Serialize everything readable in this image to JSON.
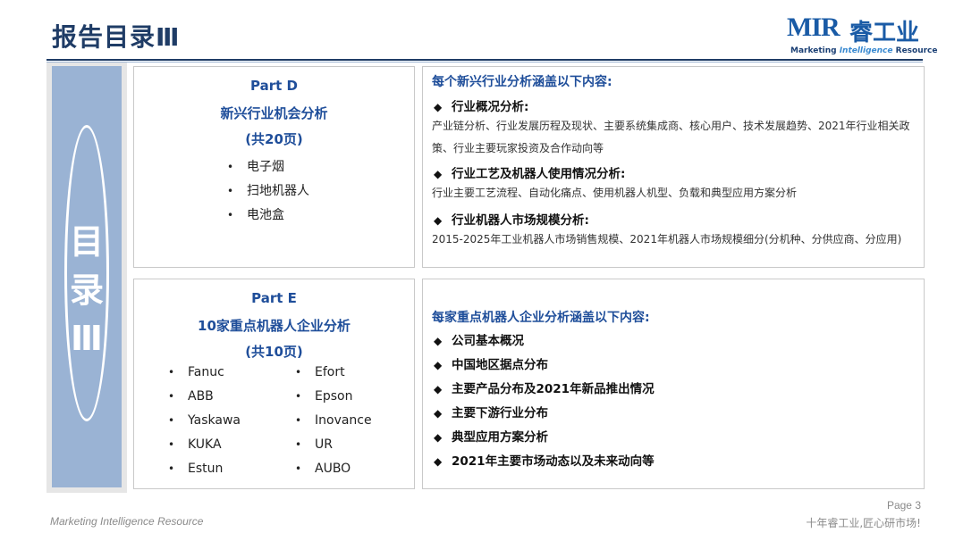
{
  "header": {
    "title": "报告目录Ⅲ"
  },
  "logo": {
    "mark": "MIR",
    "cn": "睿工业",
    "sub_a": "Marketing ",
    "sub_b": "Intelligence",
    "sub_c": " Resource"
  },
  "sidebar": {
    "line1": "目",
    "line2": "录",
    "line3": "Ⅲ"
  },
  "part_d": {
    "label": "Part D",
    "title": "新兴行业机会分析",
    "pages": "(共20页)",
    "items": [
      "电子烟",
      "扫地机器人",
      "电池盒"
    ]
  },
  "part_d_detail": {
    "heading": "每个新兴行业分析涵盖以下内容:",
    "sections": [
      {
        "title": "行业概况分析:",
        "desc": "产业链分析、行业发展历程及现状、主要系统集成商、核心用户、技术发展趋势、2021年行业相关政策、行业主要玩家投资及合作动向等"
      },
      {
        "title": "行业工艺及机器人使用情况分析:",
        "desc": "行业主要工艺流程、自动化痛点、使用机器人机型、负载和典型应用方案分析"
      },
      {
        "title": "行业机器人市场规模分析:",
        "desc": "2015-2025年工业机器人市场销售规模、2021年机器人市场规模细分(分机种、分供应商、分应用)"
      }
    ]
  },
  "part_e": {
    "label": "Part E",
    "title": "10家重点机器人企业分析",
    "pages": "(共10页)",
    "col1": [
      "Fanuc",
      "ABB",
      "Yaskawa",
      "KUKA",
      "Estun"
    ],
    "col2": [
      "Efort",
      "Epson",
      "Inovance",
      "UR",
      "AUBO"
    ]
  },
  "part_e_detail": {
    "heading": "每家重点机器人企业分析涵盖以下内容:",
    "items": [
      "公司基本概况",
      "中国地区据点分布",
      "主要产品分布及2021年新品推出情况",
      "主要下游行业分布",
      "典型应用方案分析",
      "2021年主要市场动态以及未来动向等"
    ]
  },
  "footer": {
    "brand": "Marketing Intelligence Resource",
    "page": "Page 3",
    "slogan": "十年睿工业,匠心研市场!"
  }
}
